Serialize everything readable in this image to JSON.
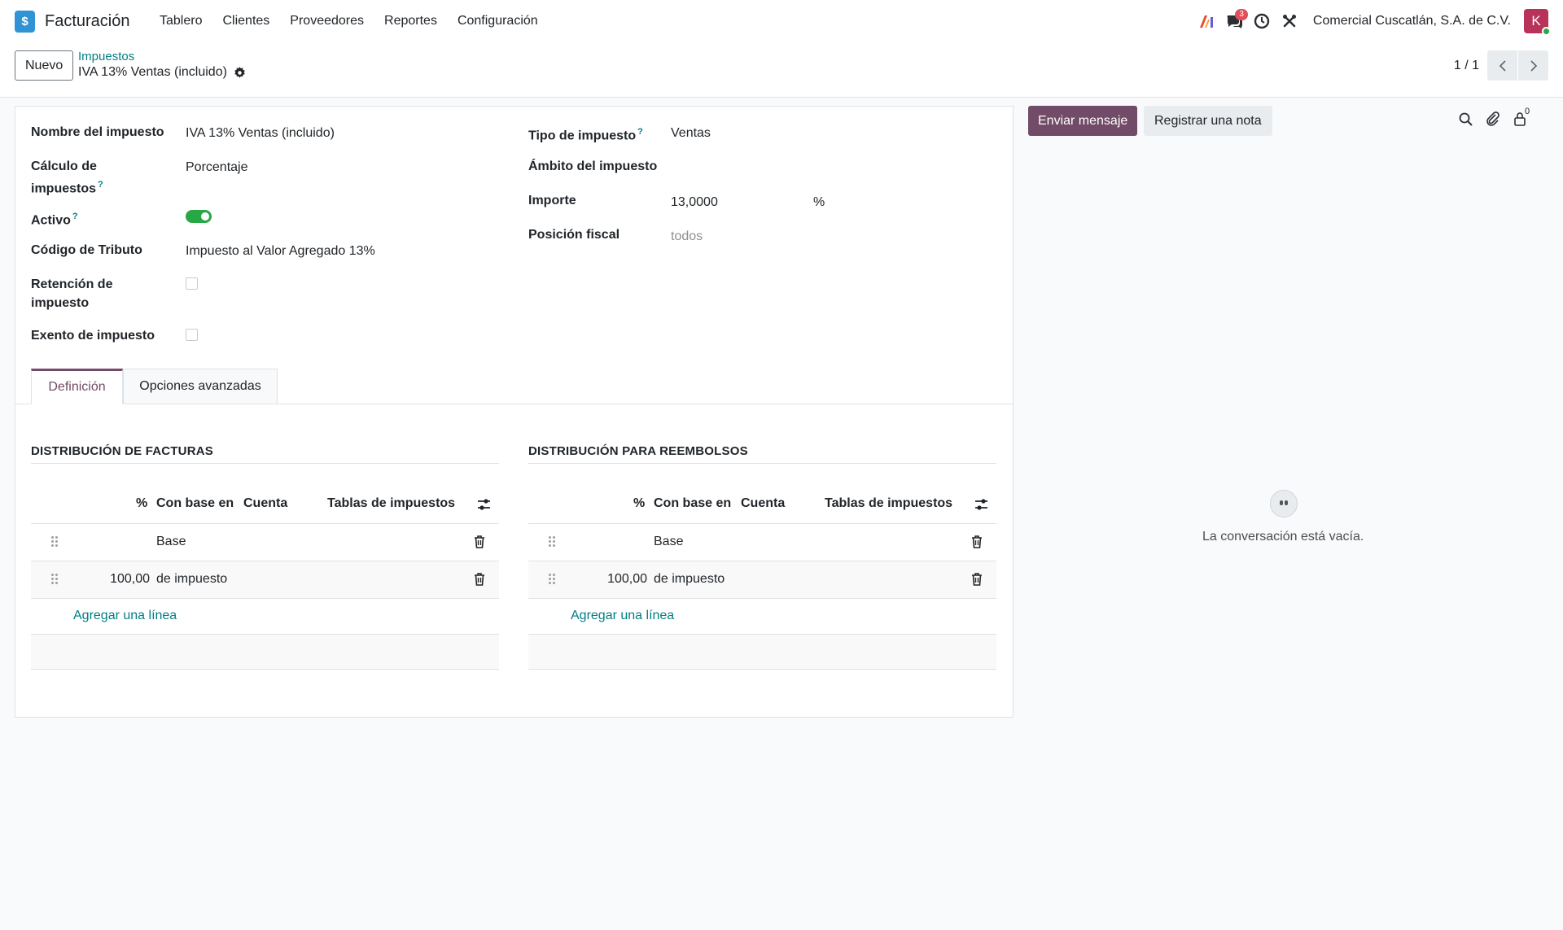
{
  "navbar": {
    "app_name": "Facturación",
    "logo_glyph": "$",
    "menu": [
      "Tablero",
      "Clientes",
      "Proveedores",
      "Reportes",
      "Configuración"
    ],
    "messages_badge": "3",
    "company": "Comercial Cuscatlán, S.A. de C.V.",
    "avatar_initial": "K"
  },
  "control": {
    "new_button": "Nuevo",
    "breadcrumb": "Impuestos",
    "record_title": "IVA 13% Ventas (incluido)",
    "pager": "1 / 1"
  },
  "form": {
    "left": {
      "name_label": "Nombre del impuesto",
      "name_value": "IVA 13% Ventas (incluido)",
      "calc_label_1": "Cálculo de",
      "calc_label_2": "impuestos",
      "calc_value": "Porcentaje",
      "active_label": "Activo",
      "active_value": true,
      "code_label": "Código de Tributo",
      "code_value": "Impuesto al Valor Agregado 13%",
      "retention_label_1": "Retención de",
      "retention_label_2": "impuesto",
      "retention_value": false,
      "exempt_label": "Exento de impuesto",
      "exempt_value": false
    },
    "right": {
      "type_label": "Tipo de impuesto",
      "type_value": "Ventas",
      "scope_label": "Ámbito del impuesto",
      "scope_value": "",
      "amount_label": "Importe",
      "amount_value": "13,0000",
      "amount_unit": "%",
      "fiscal_label": "Posición fiscal",
      "fiscal_placeholder": "todos"
    },
    "help_mark": "?",
    "tabs": [
      "Definición",
      "Opciones avanzadas"
    ]
  },
  "distribution": {
    "columns": [
      "%",
      "Con base en",
      "Cuenta",
      "Tablas de impuestos"
    ],
    "add_line": "Agregar una línea",
    "invoices": {
      "title": "DISTRIBUCIÓN DE FACTURAS",
      "rows": [
        {
          "percent": "",
          "base": "Base"
        },
        {
          "percent": "100,00",
          "base": "de impuesto"
        }
      ]
    },
    "refunds": {
      "title": "DISTRIBUCIÓN PARA REEMBOLSOS",
      "rows": [
        {
          "percent": "",
          "base": "Base"
        },
        {
          "percent": "100,00",
          "base": "de impuesto"
        }
      ]
    }
  },
  "chatter": {
    "send_message": "Enviar mensaje",
    "log_note": "Registrar una nota",
    "followers_count": "0",
    "empty_text": "La conversación está vacía."
  },
  "colors": {
    "brand": "#714b67",
    "link": "#017e84",
    "toggle_on": "#28a745",
    "badge": "#e34d5a",
    "avatar": "#b8325a"
  },
  "icons": [
    "ai-icon",
    "chat-icon",
    "clock-icon",
    "tools-icon",
    "gear-icon",
    "chevron-left-icon",
    "chevron-right-icon",
    "drag-handle-icon",
    "trash-icon",
    "optional-columns-icon",
    "search-icon",
    "paperclip-icon",
    "followers-icon",
    "empty-conversation-icon"
  ]
}
